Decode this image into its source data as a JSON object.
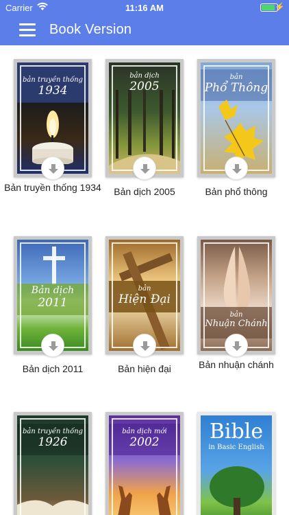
{
  "status_bar": {
    "carrier": "Carrier",
    "time": "11:16 AM"
  },
  "nav": {
    "title": "Book Version"
  },
  "books": [
    {
      "label": "Bản truyền thống 1934",
      "cover_small": "bản truyền thống",
      "cover_big": "1934"
    },
    {
      "label": "Bản dịch 2005",
      "cover_small": "bản dịch",
      "cover_big": "2005"
    },
    {
      "label": "Bản phổ thông",
      "cover_small": "bản",
      "cover_big": "Phổ Thông"
    },
    {
      "label": "Bản dịch 2011",
      "cover_small": "Bản dịch",
      "cover_big": "2011"
    },
    {
      "label": "Bản hiện đại",
      "cover_small": "bản",
      "cover_big": "Hiện Đại"
    },
    {
      "label": "Bản nhuận chánh",
      "cover_small": "bản",
      "cover_big": "Nhuận Chánh"
    },
    {
      "label": "",
      "cover_small": "bản truyền thống",
      "cover_big": "1926"
    },
    {
      "label": "",
      "cover_small": "bản dịch mới",
      "cover_big": "2002"
    },
    {
      "label": "",
      "cover_small": "in Basic English",
      "cover_big": "Bible"
    }
  ]
}
